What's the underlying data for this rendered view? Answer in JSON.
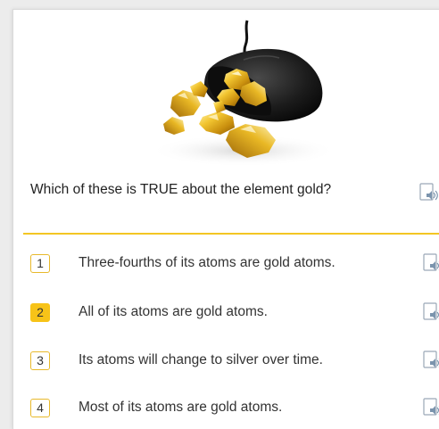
{
  "question": {
    "text": "Which of these is TRUE about the element gold?",
    "image_icon": "gold-nuggets-bag-image",
    "audio_icon": "speaker-icon"
  },
  "options": [
    {
      "number": "1",
      "text": "Three-fourths of its atoms are gold atoms.",
      "selected": false
    },
    {
      "number": "2",
      "text": "All of its atoms are gold atoms.",
      "selected": true
    },
    {
      "number": "3",
      "text": "Its atoms will change to silver over time.",
      "selected": false
    },
    {
      "number": "4",
      "text": "Most of its atoms are gold atoms.",
      "selected": false
    }
  ],
  "colors": {
    "accent": "#f3c623",
    "selected_badge": "#f7c318",
    "badge_border": "#e8b92b",
    "text": "#333333",
    "audio_icon": "#8aa0b4"
  }
}
